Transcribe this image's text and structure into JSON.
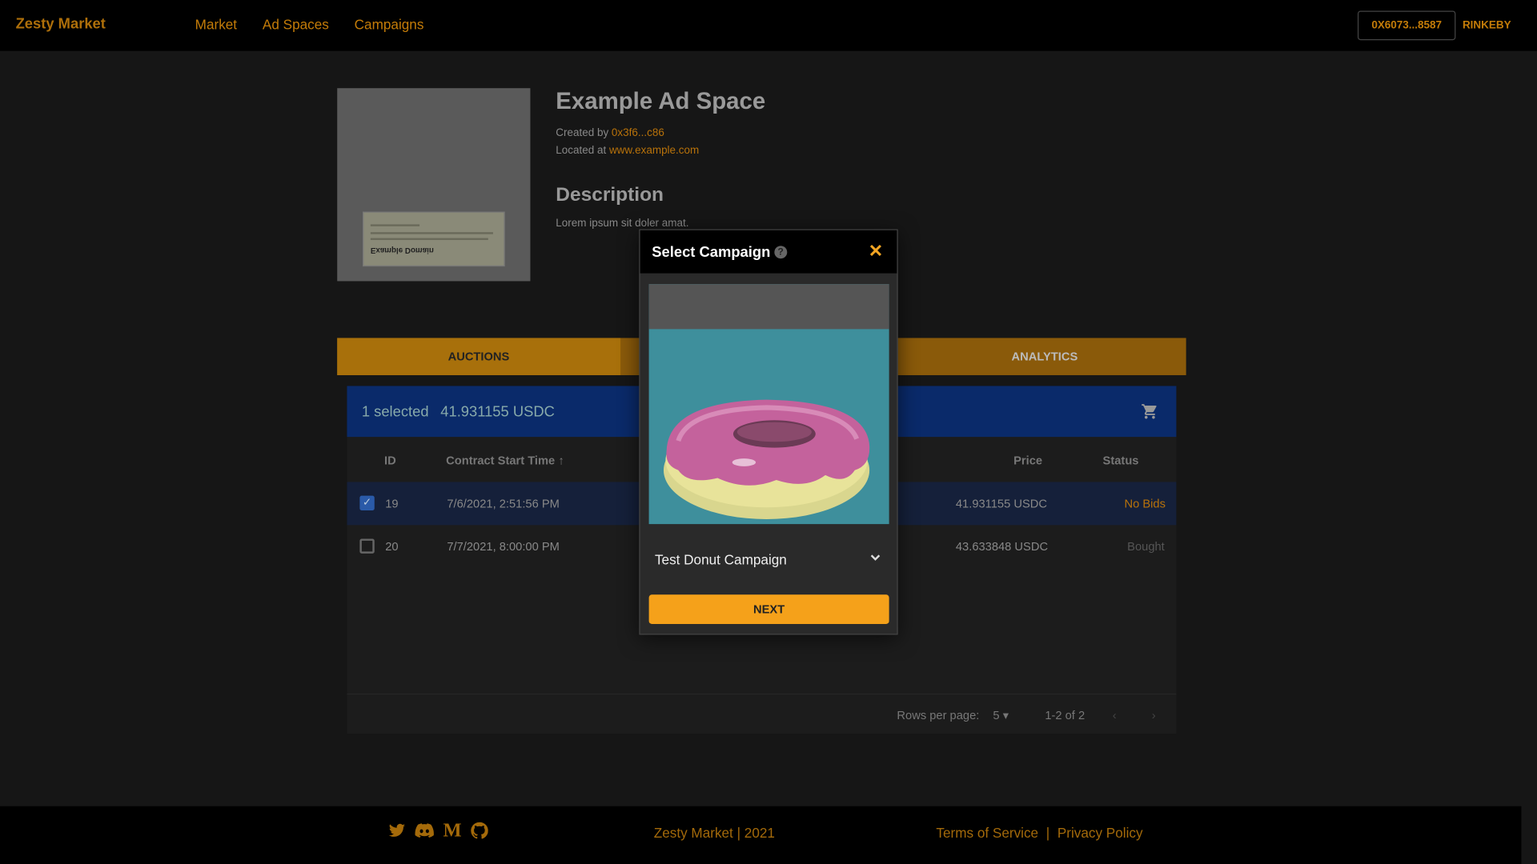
{
  "nav": {
    "brand": "Zesty Market",
    "links": [
      "Market",
      "Ad Spaces",
      "Campaigns"
    ],
    "wallet": "0X6073...8587",
    "network": "RINKEBY"
  },
  "adspace": {
    "thumb_text": "Example Domain",
    "title": "Example Ad Space",
    "created_prefix": "Created by ",
    "created_by": "0x3f6...c86",
    "located_prefix": "Located at ",
    "location": "www.example.com",
    "desc_heading": "Description",
    "desc_text": "Lorem ipsum sit doler amat."
  },
  "tabs": [
    "AUCTIONS",
    "",
    "ANALYTICS"
  ],
  "table": {
    "selected_text": "1 selected",
    "selected_total": "41.931155 USDC",
    "headers": {
      "id": "ID",
      "start": "Contract Start Time",
      "price": "Price",
      "status": "Status"
    },
    "sort_arrow": "↑",
    "rows": [
      {
        "id": "19",
        "start": "7/6/2021, 2:51:56 PM",
        "price": "41.931155 USDC",
        "status": "No Bids",
        "checked": true
      },
      {
        "id": "20",
        "start": "7/7/2021, 8:00:00 PM",
        "price": "43.633848 USDC",
        "status": "Bought",
        "checked": false
      }
    ],
    "pager": {
      "rows_label": "Rows per page:",
      "rows_value": "5",
      "range": "1-2 of 2"
    }
  },
  "modal": {
    "title": "Select Campaign",
    "help": "?",
    "close": "✕",
    "campaign": "Test Donut Campaign",
    "next": "NEXT"
  },
  "footer": {
    "copyright": "Zesty Market | 2021",
    "tos": "Terms of Service",
    "sep": "|",
    "privacy": "Privacy Policy",
    "icons": [
      "twitter-icon",
      "discord-icon",
      "medium-icon",
      "github-icon"
    ]
  },
  "colors": {
    "accent": "#f5a11a",
    "link": "#b8720a",
    "selbar": "#0a2a6a",
    "no_bids": "#c47c08"
  }
}
